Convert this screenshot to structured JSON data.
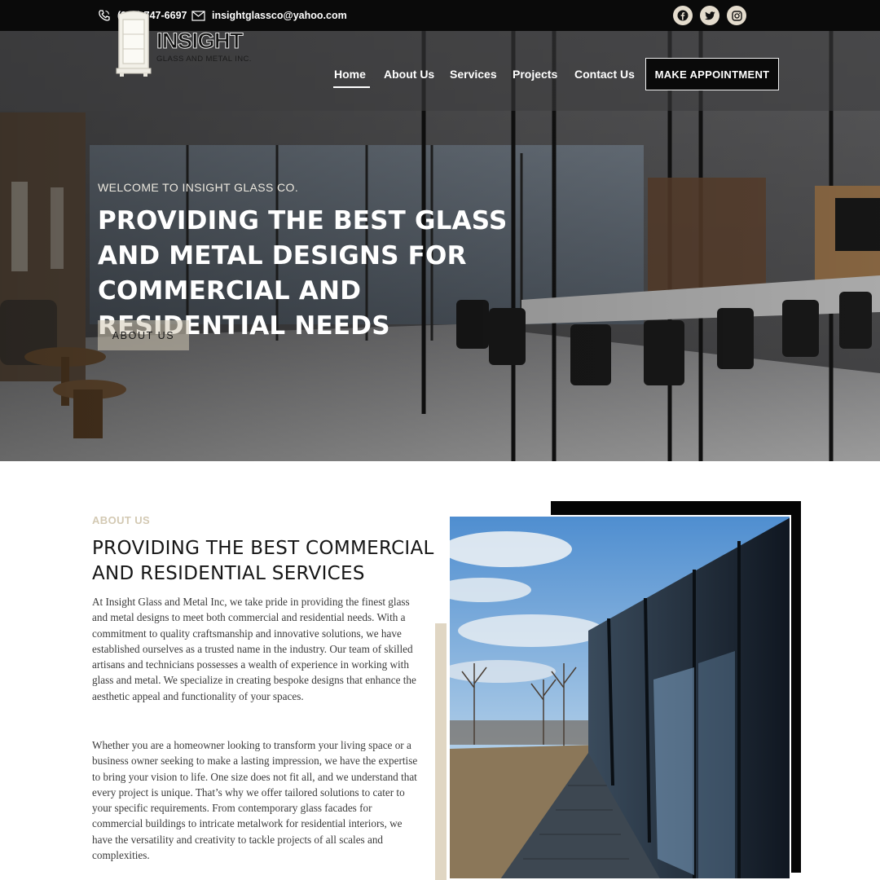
{
  "topbar": {
    "phone": "(916) 747-6697",
    "email": "insightglassco@yahoo.com",
    "phone_icon": "phone-icon",
    "email_icon": "envelope-icon",
    "socials": [
      "facebook-icon",
      "twitter-icon",
      "instagram-icon"
    ]
  },
  "header": {
    "logo_word": "INSIGHT",
    "logo_sub": "GLASS AND METAL INC.",
    "nav": [
      "Home",
      "About Us",
      "Services",
      "Projects",
      "Contact Us"
    ],
    "active_nav": "Home",
    "cta": "MAKE APPOINTMENT"
  },
  "hero": {
    "eyebrow": "WELCOME TO INSIGHT GLASS CO.",
    "title": "PROVIDING THE BEST GLASS AND METAL DESIGNS FOR COMMERCIAL AND RESIDENTIAL NEEDS",
    "button": "ABOUT US"
  },
  "about": {
    "label": "ABOUT US",
    "title": "PROVIDING THE BEST COMMERCIAL AND RESIDENTIAL SERVICES",
    "p1": "At Insight Glass and Metal Inc, we take pride in providing the finest glass and metal designs to meet both commercial and residential needs. With a commitment to quality craftsmanship and innovative solutions, we have established ourselves as a trusted name in the industry. Our team of skilled artisans and technicians possesses a wealth of experience in working with glass and metal. We specialize in creating bespoke designs that enhance the aesthetic appeal and functionality of your spaces.",
    "p2": "Whether you are a homeowner looking to transform your living space or a business owner seeking to make a lasting impression, we have the expertise to bring your vision to life. One size does not fit all, and we understand that every project is unique. That’s why we offer tailored solutions to cater to your specific requirements. From contemporary glass facades for commercial buildings to intricate metalwork for residential interiors, we have the versatility and creativity to tackle projects of all scales and complexities."
  },
  "colors": {
    "topbar": "#0a0a0a",
    "accent_tan": "#d3c9b3",
    "text_dark": "#161616",
    "button_black": "#0a0a0a"
  }
}
